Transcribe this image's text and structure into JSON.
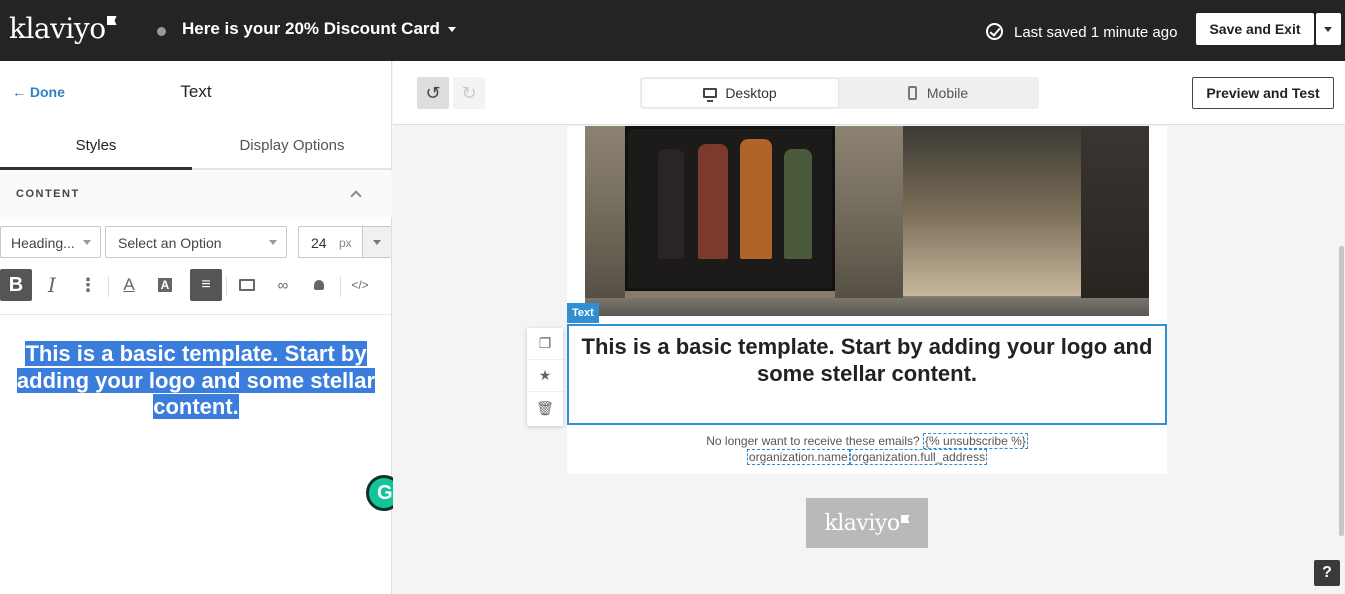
{
  "app": {
    "brand": "klaviyo"
  },
  "header": {
    "title": "Here is your 20% Discount Card",
    "saved_status": "Last saved 1 minute ago",
    "save_exit_label": "Save and Exit"
  },
  "sidebar": {
    "done_label": "Done",
    "panel_title": "Text",
    "tabs": [
      {
        "label": "Styles"
      },
      {
        "label": "Display Options"
      }
    ],
    "section_label": "CONTENT",
    "heading_select": "Heading...",
    "option_select": "Select an Option",
    "font_size": "24",
    "font_unit": "px",
    "editor_text": "This is a basic template. Start by adding your logo and some stellar content."
  },
  "toolbar_main": {
    "desktop_label": "Desktop",
    "mobile_label": "Mobile",
    "preview_label": "Preview and Test"
  },
  "email": {
    "block_tag": "Text",
    "body_text": "This is a basic template. Start by adding your logo and some stellar content.",
    "footer_line1": "No longer want to receive these emails?",
    "unsubscribe_tag": "{% unsubscribe %}",
    "org_name_tag": "organization.name",
    "org_address_tag": "organization.full_address"
  },
  "badge": {
    "brand": "klaviyo"
  },
  "help_label": "?",
  "colors": {
    "accent": "#2f80c5",
    "topbar": "#232426",
    "selection": "#3b7ddd"
  }
}
